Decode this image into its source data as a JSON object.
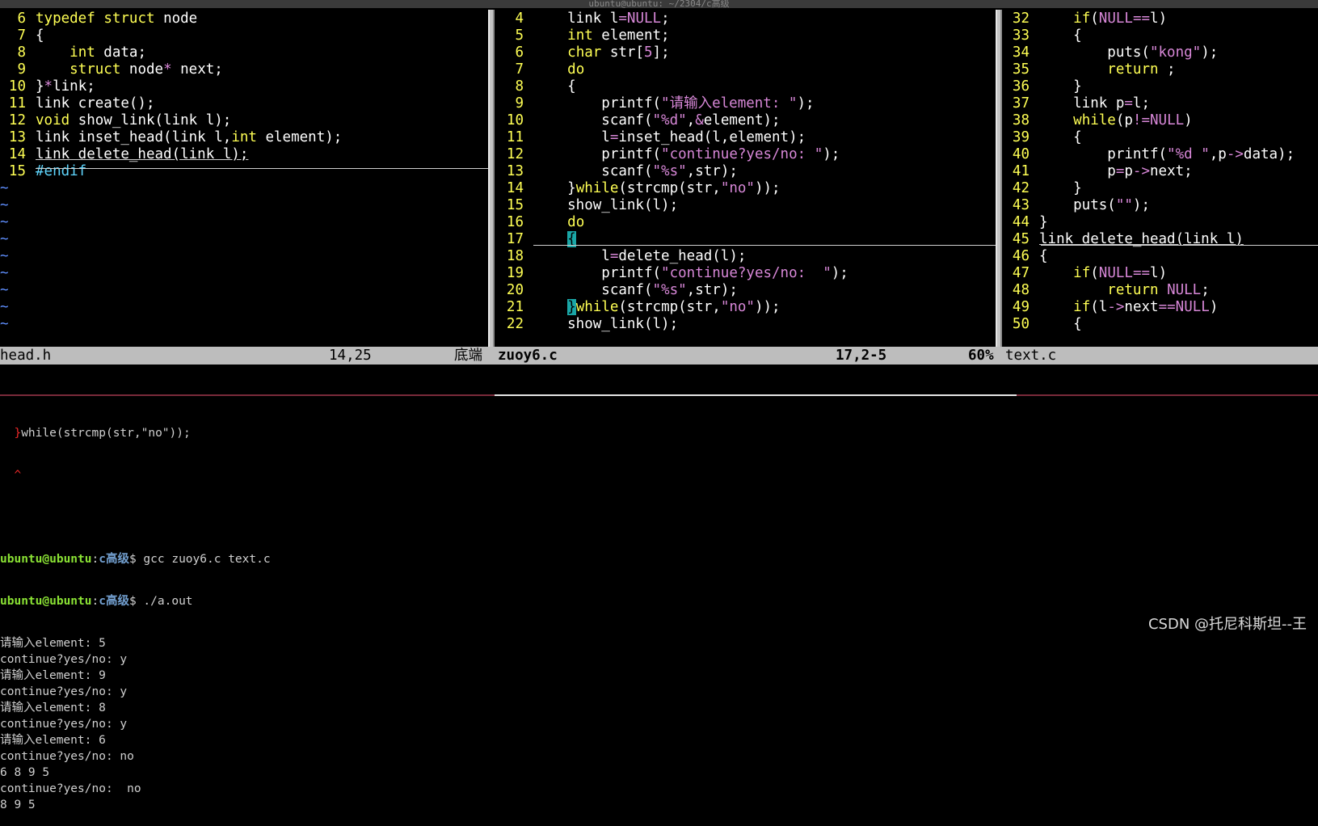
{
  "window": {
    "title": "ubuntu@ubuntu: ~/2304/c高级"
  },
  "pane1": {
    "filename": "head.h",
    "position": "14,25",
    "scroll": "底端",
    "lines": [
      {
        "n": "6",
        "t": "typedef struct node"
      },
      {
        "n": "7",
        "t": "{"
      },
      {
        "n": "8",
        "t": "    int data;"
      },
      {
        "n": "9",
        "t": "    struct node* next;"
      },
      {
        "n": "10",
        "t": "}*link;"
      },
      {
        "n": "11",
        "t": "link create();"
      },
      {
        "n": "12",
        "t": "void show_link(link l);"
      },
      {
        "n": "13",
        "t": "link inset_head(link l,int element);"
      },
      {
        "n": "14",
        "t": "link delete_head(link l);"
      },
      {
        "n": "15",
        "t": "#endif"
      }
    ],
    "tilde": "~"
  },
  "pane2": {
    "filename": "zuoy6.c",
    "position": "17,2-5",
    "scroll": "60%",
    "lines": [
      {
        "n": "4",
        "t": "    link l=NULL;"
      },
      {
        "n": "5",
        "t": "    int element;"
      },
      {
        "n": "6",
        "t": "    char str[5];"
      },
      {
        "n": "7",
        "t": "    do"
      },
      {
        "n": "8",
        "t": "    {"
      },
      {
        "n": "9",
        "t": "        printf(\"请输入element: \");"
      },
      {
        "n": "10",
        "t": "        scanf(\"%d\",&element);"
      },
      {
        "n": "11",
        "t": "        l=inset_head(l,element);"
      },
      {
        "n": "12",
        "t": "        printf(\"continue?yes/no: \");"
      },
      {
        "n": "13",
        "t": "        scanf(\"%s\",str);"
      },
      {
        "n": "14",
        "t": "    }while(strcmp(str,\"no\"));"
      },
      {
        "n": "15",
        "t": "    show_link(l);"
      },
      {
        "n": "16",
        "t": "    do"
      },
      {
        "n": "17",
        "t": "    {"
      },
      {
        "n": "18",
        "t": "        l=delete_head(l);"
      },
      {
        "n": "19",
        "t": "        printf(\"continue?yes/no:  \");"
      },
      {
        "n": "20",
        "t": "        scanf(\"%s\",str);"
      },
      {
        "n": "21",
        "t": "    }while(strcmp(str,\"no\"));"
      },
      {
        "n": "22",
        "t": "    show_link(l);"
      }
    ]
  },
  "pane3": {
    "filename": "text.c",
    "lines": [
      {
        "n": "32",
        "t": "    if(NULL==l)"
      },
      {
        "n": "33",
        "t": "    {"
      },
      {
        "n": "34",
        "t": "        puts(\"kong\");"
      },
      {
        "n": "35",
        "t": "        return ;"
      },
      {
        "n": "36",
        "t": "    }"
      },
      {
        "n": "37",
        "t": "    link p=l;"
      },
      {
        "n": "38",
        "t": "    while(p!=NULL)"
      },
      {
        "n": "39",
        "t": "    {"
      },
      {
        "n": "40",
        "t": "        printf(\"%d \",p->data);"
      },
      {
        "n": "41",
        "t": "        p=p->next;"
      },
      {
        "n": "42",
        "t": "    }"
      },
      {
        "n": "43",
        "t": "    puts(\"\");"
      },
      {
        "n": "44",
        "t": "}"
      },
      {
        "n": "45",
        "t": "link delete_head(link l)"
      },
      {
        "n": "46",
        "t": "{"
      },
      {
        "n": "47",
        "t": "    if(NULL==l)"
      },
      {
        "n": "48",
        "t": "        return NULL;"
      },
      {
        "n": "49",
        "t": "    if(l->next==NULL)"
      },
      {
        "n": "50",
        "t": "    {"
      }
    ]
  },
  "terminal": {
    "error_line": "  }while(strcmp(str,\"no\"));",
    "caret": "  ^",
    "prompt_user": "ubuntu@ubuntu",
    "prompt_path": "c高级",
    "cmd1": " gcc zuoy6.c text.c",
    "cmd2": " ./a.out",
    "output": [
      "请输入element: 5",
      "continue?yes/no: y",
      "请输入element: 9",
      "continue?yes/no: y",
      "请输入element: 8",
      "continue?yes/no: y",
      "请输入element: 6",
      "continue?yes/no: no",
      "6 8 9 5",
      "continue?yes/no:  no",
      "8 9 5"
    ]
  },
  "watermark": "CSDN @托尼科斯坦--王",
  "colors": {
    "background": "#000000",
    "line_number": "#ffff54",
    "keyword": "#ffff54",
    "type": "#7ee787",
    "string": "#d787d7",
    "status_bar": "#bdbdbd",
    "cursor": "#1aa6a6"
  }
}
